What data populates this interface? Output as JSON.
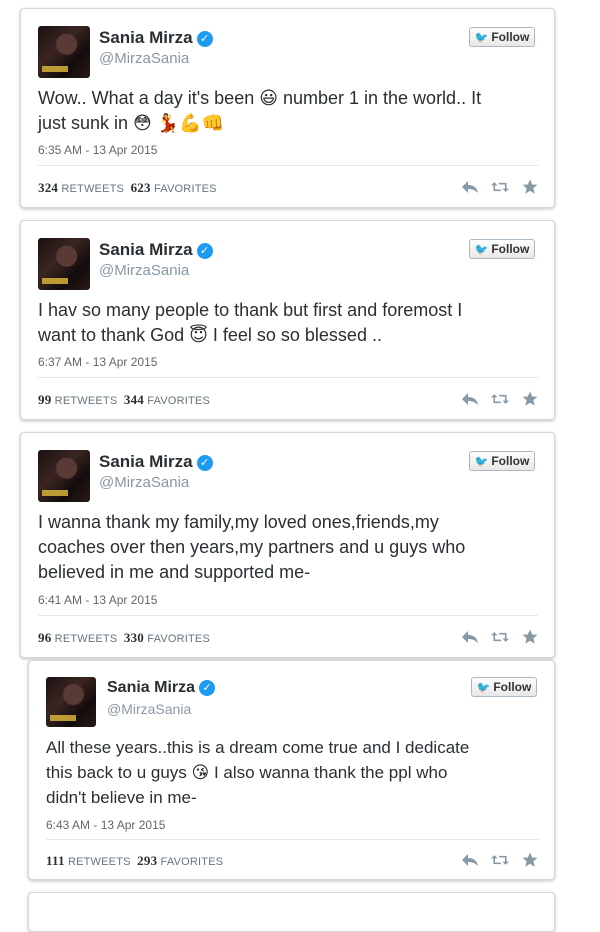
{
  "follow_label": "Follow",
  "retweets_word": "RETWEETS",
  "favorites_word": "FAVORITES",
  "tweets": [
    {
      "name": "Sania Mirza",
      "handle": "@MirzaSania",
      "lines": [
        "Wow.. What a day it's been 😃 number 1 in the world.. It",
        "just sunk in 😳 💃💪👊"
      ],
      "time": "6:35 AM - 13 Apr 2015",
      "retweets": "324",
      "favorites": "623"
    },
    {
      "name": "Sania Mirza",
      "handle": "@MirzaSania",
      "lines": [
        "I hav so many people to thank but first and foremost I",
        "want to thank God 😇 I feel so so blessed .."
      ],
      "time": "6:37 AM - 13 Apr 2015",
      "retweets": "99",
      "favorites": "344"
    },
    {
      "name": "Sania Mirza",
      "handle": "@MirzaSania",
      "lines": [
        "I wanna thank my family,my loved ones,friends,my",
        "coaches over then years,my partners and u guys who",
        "believed in me and supported me-"
      ],
      "time": "6:41 AM - 13 Apr 2015",
      "retweets": "96",
      "favorites": "330"
    },
    {
      "name": "Sania Mirza",
      "handle": "@MirzaSania",
      "lines": [
        "All these years..this is a dream come true and I dedicate",
        "this back to u guys 😘 I also wanna thank the ppl who",
        "didn't believe in me-"
      ],
      "time": "6:43 AM - 13 Apr 2015",
      "retweets": "111",
      "favorites": "293"
    }
  ],
  "icons": [
    "reply-icon",
    "retweet-icon",
    "favorite-icon",
    "verified-icon",
    "twitter-bird-icon"
  ]
}
